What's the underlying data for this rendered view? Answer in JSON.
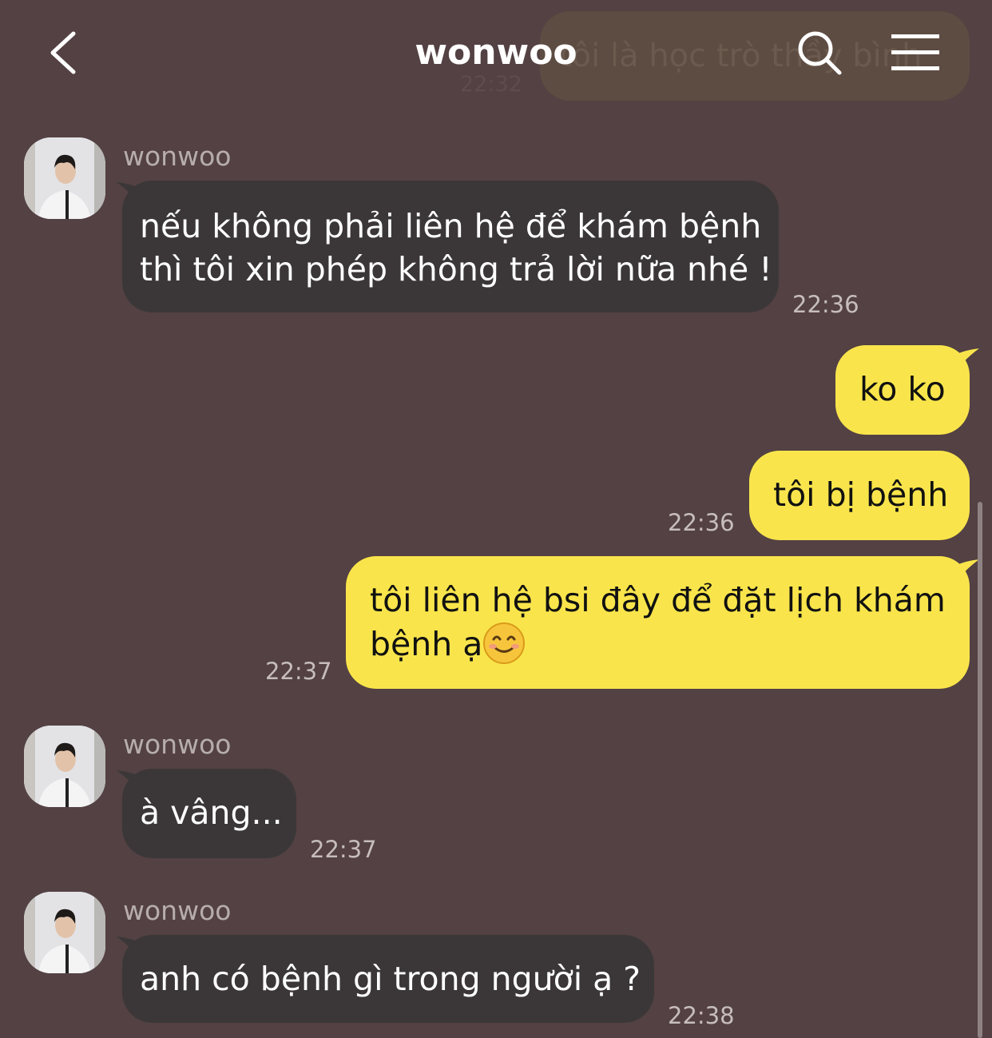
{
  "header": {
    "title": "wonwoo",
    "ghost_message": "tôi là học trò thầy bình",
    "ghost_time": "22:32"
  },
  "messages": [
    {
      "from": "wonwoo",
      "sender_label": "wonwoo",
      "lines": [
        "nếu không phải liên hệ để khám bệnh",
        "thì tôi xin phép không trả lời nữa nhé !"
      ],
      "time": "22:36"
    },
    {
      "from": "me",
      "text": "ko ko"
    },
    {
      "from": "me",
      "text": "tôi bị bệnh",
      "time": "22:36"
    },
    {
      "from": "me",
      "lines": [
        "tôi liên hệ bsi đây để đặt lịch khám",
        "bệnh ạ"
      ],
      "emoji": "smiling-face-emoji",
      "time": "22:37"
    },
    {
      "from": "wonwoo",
      "sender_label": "wonwoo",
      "text": "à vâng...",
      "time": "22:37"
    },
    {
      "from": "wonwoo",
      "sender_label": "wonwoo",
      "text": "anh có bệnh gì trong người ạ ?",
      "time": "22:38"
    }
  ],
  "colors": {
    "background": "#534143",
    "incoming_bubble": "#3b3738",
    "outgoing_bubble": "#f9e54b"
  },
  "icons": [
    "back-icon",
    "search-icon",
    "menu-icon"
  ]
}
